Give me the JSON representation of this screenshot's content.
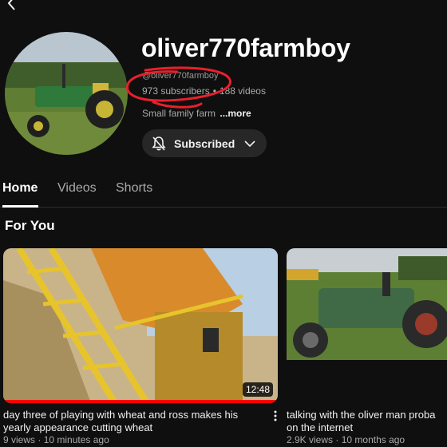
{
  "channel": {
    "name": "oliver770farmboy",
    "handle": "@oliver770farmboy",
    "subscribers": "973 subscribers",
    "separator": "•",
    "videos": "188 videos",
    "description": "Small family farm",
    "more": "...more",
    "subscribe_label": "Subscribed",
    "annotation_color": "#e8202c"
  },
  "tabs": [
    {
      "label": "Home"
    },
    {
      "label": "Videos"
    },
    {
      "label": "Shorts"
    }
  ],
  "section": {
    "title": "For You"
  },
  "videos": [
    {
      "title_line1": "day three of playing with wheat and ross makes his",
      "title_line2": "yearly appearance cutting wheat",
      "views": "9 views",
      "age": "10 minutes ago",
      "meta_separator": "·",
      "duration": "12:48",
      "watched_fraction": 1.0
    },
    {
      "title_line1": "talking with the oliver man proba",
      "title_line2": "on the internet",
      "views": "2.9K views",
      "age": "10 months ago",
      "meta_separator": "·"
    }
  ],
  "icons": {
    "back": "chevron-left-icon",
    "bell": "bell-slash-icon",
    "dropdown": "chevron-down-icon",
    "menu": "more-vert-icon"
  },
  "colors": {
    "background": "#0f0f0f",
    "progress": "#ff0000",
    "button": "#272727"
  }
}
